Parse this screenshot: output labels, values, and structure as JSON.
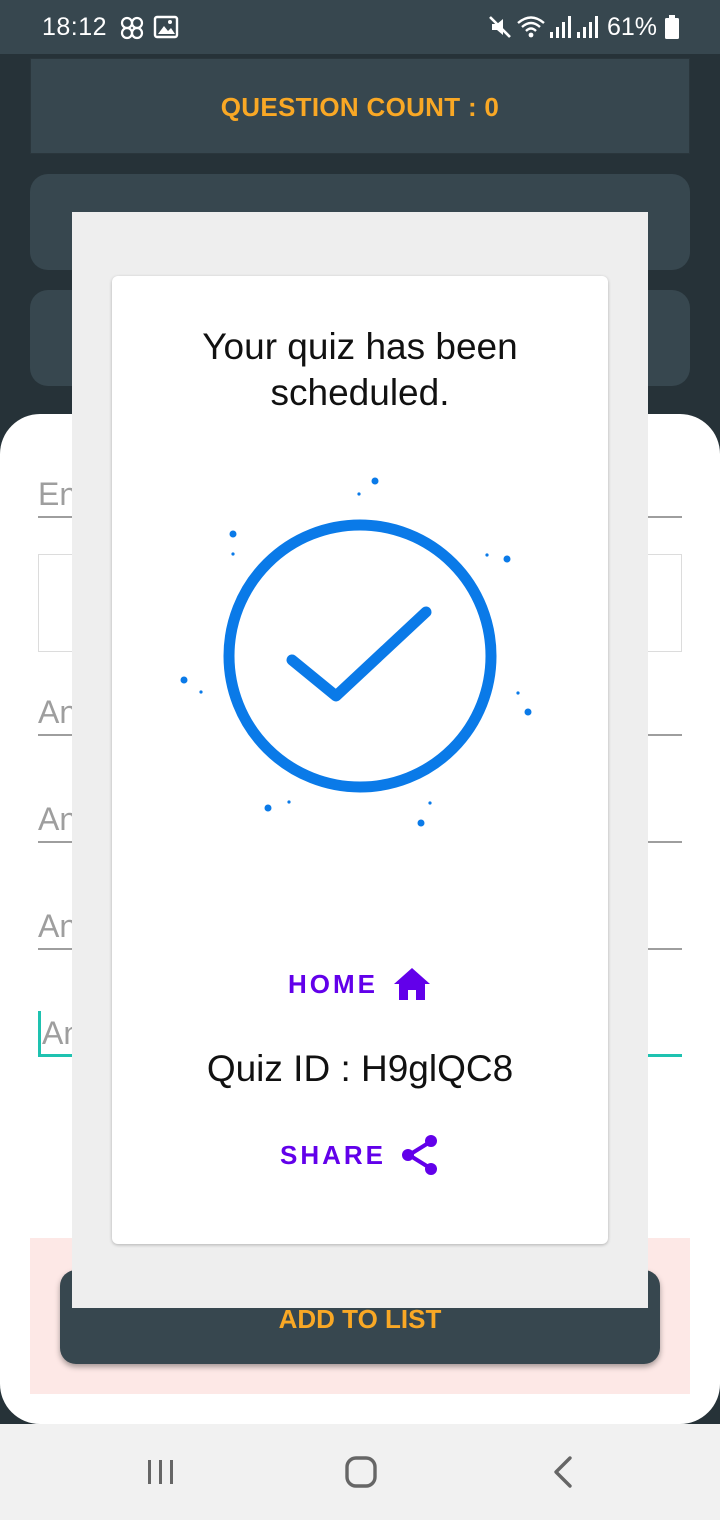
{
  "status_bar": {
    "time": "18:12",
    "battery": "61%",
    "icons": [
      "flower-icon",
      "gallery-icon",
      "mute-icon",
      "wifi-icon",
      "signal-icon",
      "signal-icon",
      "battery-icon"
    ]
  },
  "background": {
    "question_count_label": "QUESTION COUNT : 0",
    "fields": [
      {
        "placeholder": "En"
      },
      {
        "placeholder": "An"
      },
      {
        "placeholder": "An"
      },
      {
        "placeholder": "An"
      },
      {
        "placeholder": "An"
      }
    ],
    "add_button_label": "ADD TO LIST"
  },
  "dialog": {
    "message": "Your quiz has been scheduled.",
    "home_label": "HOME",
    "quiz_id_text": "Quiz ID : H9glQC8",
    "share_label": "SHARE"
  },
  "colors": {
    "accent_orange": "#f9a825",
    "link_purple": "#6200ea",
    "check_blue": "#0a7ae8",
    "teal_focus": "#1ec2b0",
    "dark_bg": "#263238",
    "card_bg": "#37474f"
  },
  "nav": {
    "icons": [
      "recents-icon",
      "home-nav-icon",
      "back-icon"
    ]
  }
}
